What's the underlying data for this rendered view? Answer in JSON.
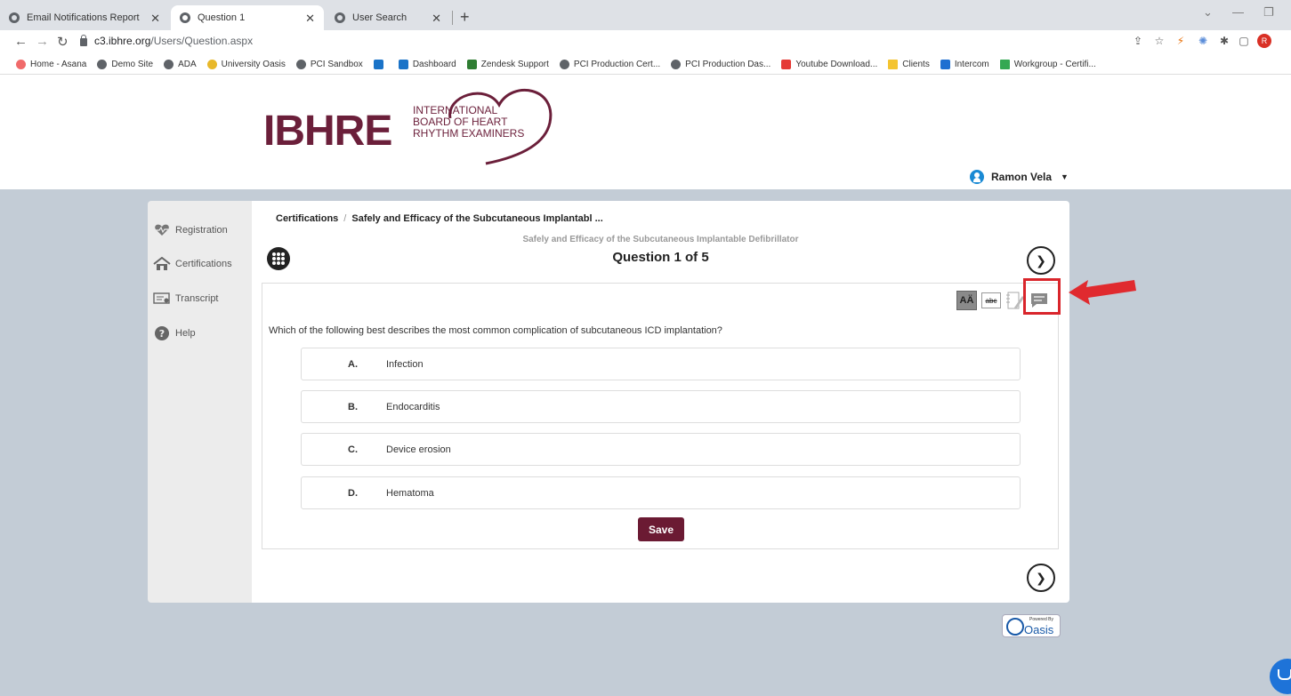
{
  "browser": {
    "tabs": [
      {
        "label": "Email Notifications Report",
        "active": false
      },
      {
        "label": "Question 1",
        "active": true
      },
      {
        "label": "User Search",
        "active": false
      }
    ],
    "url_host": "c3.ibhre.org",
    "url_path": "/Users/Question.aspx",
    "bookmarks": [
      {
        "label": "Home - Asana",
        "color": "#f06a6a"
      },
      {
        "label": "Demo Site",
        "color": "#5f6368"
      },
      {
        "label": "ADA",
        "color": "#5f6368"
      },
      {
        "label": "University Oasis",
        "color": "#e8b82a"
      },
      {
        "label": "PCI Sandbox",
        "color": "#5f6368"
      },
      {
        "label": "",
        "color": "#1a73c8"
      },
      {
        "label": "Dashboard",
        "color": "#1a73c8"
      },
      {
        "label": "Zendesk Support",
        "color": "#2f7d32"
      },
      {
        "label": "PCI Production Cert...",
        "color": "#5f6368"
      },
      {
        "label": "PCI Production Das...",
        "color": "#5f6368"
      },
      {
        "label": "Youtube Download...",
        "color": "#e53935"
      },
      {
        "label": "Clients",
        "color": "#f4c430"
      },
      {
        "label": "Intercom",
        "color": "#1f6fd1"
      },
      {
        "label": "Workgroup - Certifi...",
        "color": "#34a853"
      }
    ]
  },
  "logo": {
    "wordmark": "IBHRE",
    "line1": "INTERNATIONAL",
    "line2": "BOARD OF HEART",
    "line3": "RHYTHM EXAMINERS",
    "brand_color": "#6b1f3a"
  },
  "user": {
    "name": "Ramon Vela"
  },
  "sidebar": {
    "items": [
      {
        "label": "Registration",
        "icon": "heart-pulse-icon"
      },
      {
        "label": "Certifications",
        "icon": "home-icon"
      },
      {
        "label": "Transcript",
        "icon": "certificate-icon"
      },
      {
        "label": "Help",
        "icon": "question-circle-icon"
      }
    ]
  },
  "content": {
    "breadcrumb_root": "Certifications",
    "breadcrumb_separator": "/",
    "breadcrumb_current": "Safely and Efficacy of the Subcutaneous Implantabl ...",
    "course_title": "Safely and Efficacy of the Subcutaneous Implantable Defibrillator",
    "question_number": "Question 1 of 5",
    "question_text": "Which of the following best describes the most common complication of subcutaneous ICD implantation?",
    "options": [
      {
        "letter": "A.",
        "text": "Infection"
      },
      {
        "letter": "B.",
        "text": "Endocarditis"
      },
      {
        "letter": "C.",
        "text": "Device erosion"
      },
      {
        "letter": "D.",
        "text": "Hematoma"
      }
    ],
    "save_label": "Save",
    "tool_font_label": "AÄ",
    "tool_strike_label": "abc"
  },
  "footer": {
    "powered_by": "Powered By",
    "oasis": "Oasis"
  },
  "colors": {
    "accent": "#6b1a33",
    "annotation": "#d9252b",
    "background": "#c3ccd6"
  }
}
